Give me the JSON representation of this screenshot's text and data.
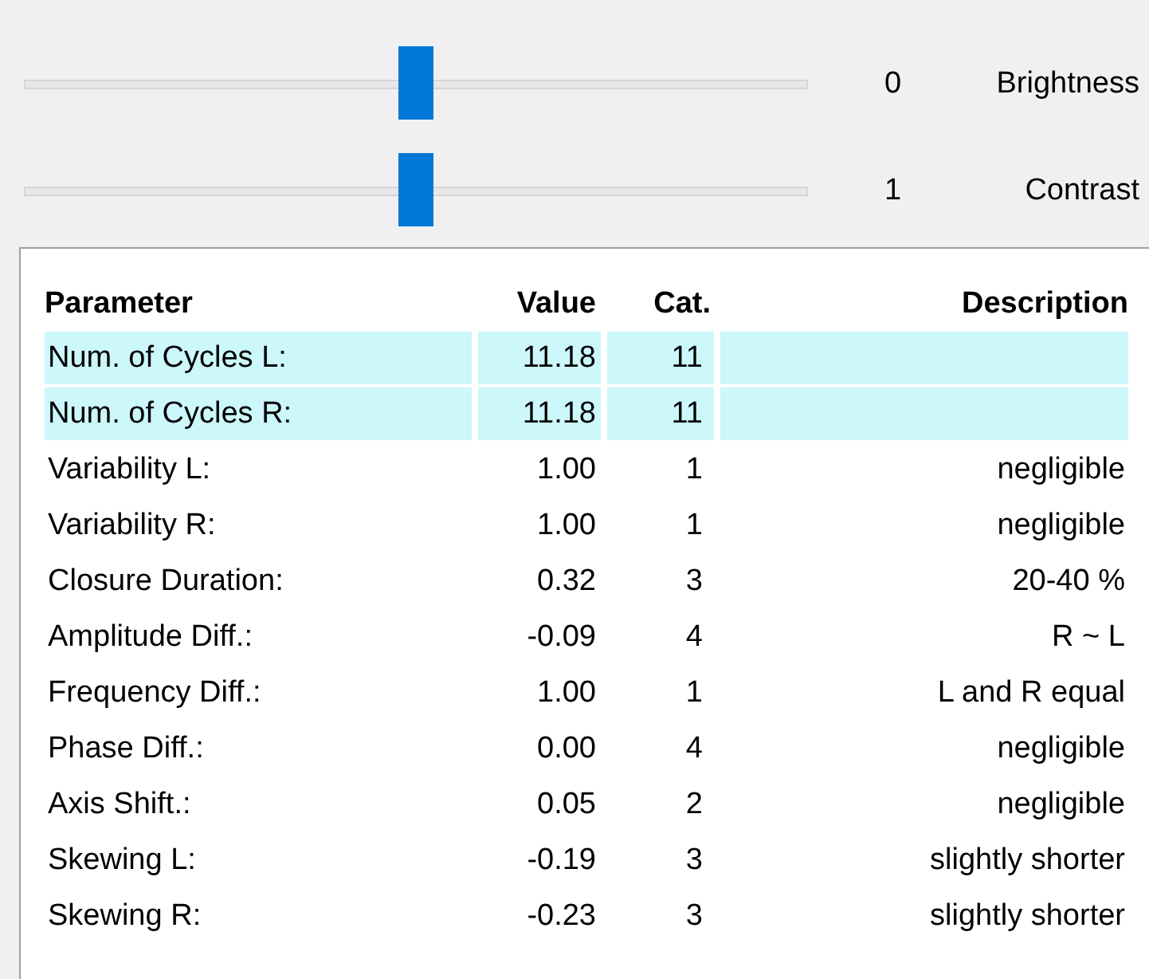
{
  "sliders": [
    {
      "level": 0.5,
      "value": "0",
      "label": "Brightness"
    },
    {
      "level": 0.5,
      "value": "1",
      "label": "Contrast"
    }
  ],
  "table": {
    "columns": [
      "Parameter",
      "Value",
      "Cat.",
      "Description"
    ],
    "rows": [
      {
        "cells": [
          "Num. of Cycles L:",
          "11.18",
          "11"
        ],
        "highlighted": true
      },
      {
        "cells": [
          "Num. of Cycles R:",
          "11.18",
          "11"
        ],
        "highlighted": true
      },
      {
        "cells": [
          "Variability L:",
          "1.00",
          "1",
          "negligible"
        ],
        "highlighted": false
      },
      {
        "cells": [
          "Variability R:",
          "1.00",
          "1",
          "negligible"
        ],
        "highlighted": false
      },
      {
        "cells": [
          "Closure Duration:",
          "0.32",
          "3",
          "20-40 %"
        ],
        "highlighted": false
      },
      {
        "cells": [
          "Amplitude Diff.:",
          "-0.09",
          "4",
          "R ~ L"
        ],
        "highlighted": false
      },
      {
        "cells": [
          "Frequency Diff.:",
          "1.00",
          "1",
          "L and R equal"
        ],
        "highlighted": false
      },
      {
        "cells": [
          "Phase Diff.:",
          "0.00",
          "4",
          "negligible"
        ],
        "highlighted": false
      },
      {
        "cells": [
          "Axis Shift.:",
          "0.05",
          "2",
          "negligible"
        ],
        "highlighted": false
      },
      {
        "cells": [
          "Skewing L:",
          "-0.19",
          "3",
          "slightly shorter"
        ],
        "highlighted": false
      },
      {
        "cells": [
          "Skewing R:",
          "-0.23",
          "3",
          "slightly shorter"
        ],
        "highlighted": false
      }
    ]
  }
}
